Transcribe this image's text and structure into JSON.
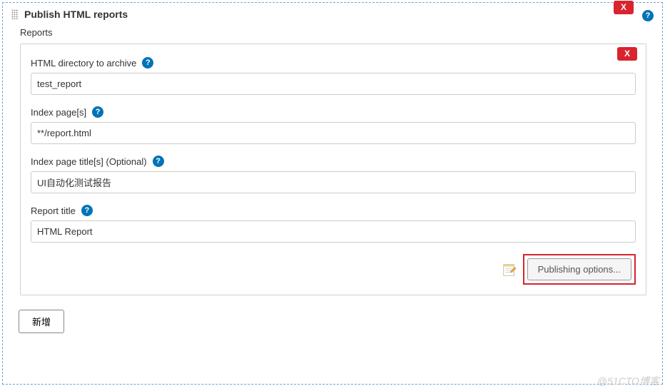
{
  "section": {
    "title": "Publish HTML reports",
    "sub_label": "Reports",
    "delete_label": "X"
  },
  "report": {
    "delete_label": "X",
    "fields": {
      "html_dir": {
        "label": "HTML directory to archive",
        "value": "test_report"
      },
      "index_pages": {
        "label": "Index page[s]",
        "value": "**/report.html"
      },
      "index_titles": {
        "label": "Index page title[s] (Optional)",
        "value": "UI自动化测试报告"
      },
      "report_title": {
        "label": "Report title",
        "value": "HTML Report"
      }
    },
    "publishing_button": "Publishing options..."
  },
  "buttons": {
    "add": "新增"
  },
  "watermark": "@51CTO博客"
}
